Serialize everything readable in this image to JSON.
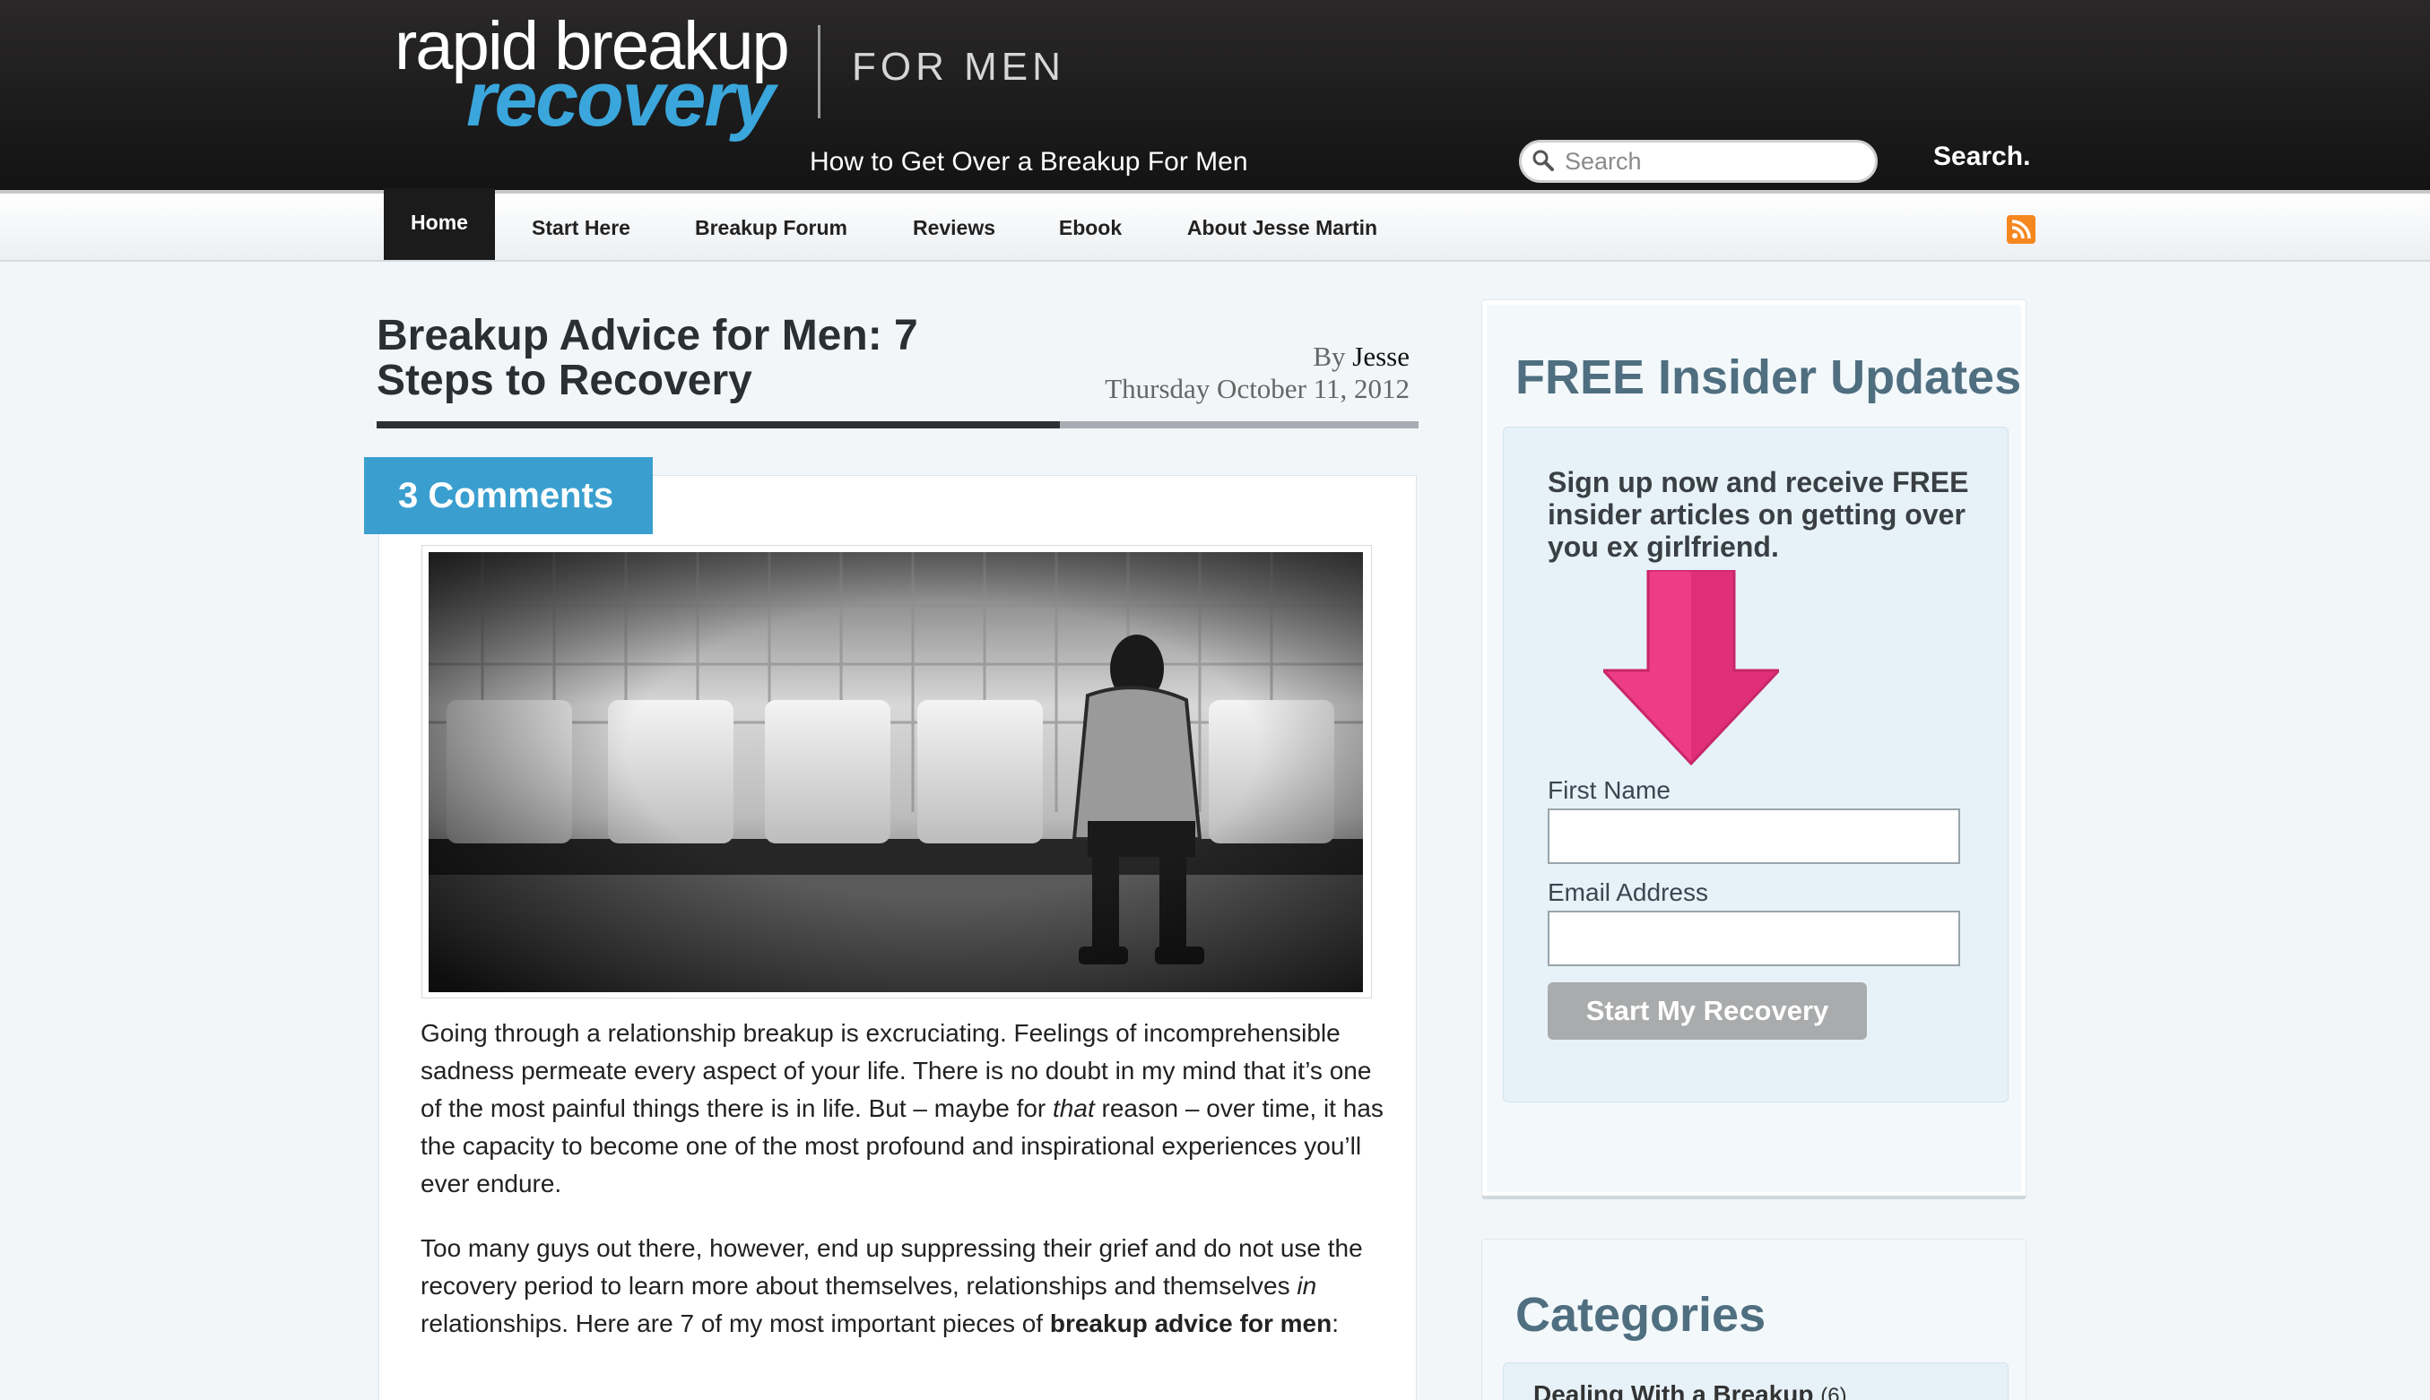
{
  "header": {
    "logo_line1": "rapid breakup",
    "logo_line2": "recovery",
    "sub_brand": "FOR MEN",
    "tagline": "How to Get Over a Breakup For Men",
    "search_placeholder": "Search",
    "search_button": "Search."
  },
  "nav": {
    "items": [
      "Home",
      "Start Here",
      "Breakup Forum",
      "Reviews",
      "Ebook",
      "About Jesse Martin"
    ],
    "active": "Home",
    "rss_icon": "rss-icon"
  },
  "post": {
    "title": "Breakup Advice for Men: 7 Steps to Recovery",
    "by_label": "By",
    "author": "Jesse",
    "date": "Thursday October 11, 2012",
    "comments_label": "3 Comments",
    "image": "man sitting alone on bench black-and-white photo",
    "paragraph1": {
      "before": "Going through a relationship breakup is excruciating. Feelings of incomprehensible sadness permeate every aspect of your life. There is no doubt in my mind that it’s one of the most painful things there is in life. But – maybe for ",
      "em": "that",
      "after": " reason – over time, it has the capacity to become one of the most profound and inspirational experiences you’ll ever endure."
    },
    "paragraph2": {
      "before": "Too many guys out there, however, end up suppressing their grief and do not use the recovery period to learn more about themselves, relationships and themselves ",
      "em": "in",
      "middle": " relationships. Here are 7 of my most important pieces of ",
      "strong": "breakup advice for men",
      "after": ":"
    }
  },
  "sidebar": {
    "widget_title": "FREE Insider Updates",
    "signup_text": "Sign up now and receive FREE insider articles on getting over you ex girlfriend.",
    "first_name_label": "First Name",
    "email_label": "Email Address",
    "submit_label": "Start My Recovery",
    "arrow_icon": "arrow-down-icon",
    "arrow_color": "#ee3c86",
    "categories_title": "Categories",
    "category_item": "Dealing With a Breakup",
    "category_count": "(6)"
  },
  "colors": {
    "accent_blue": "#3a9fcf",
    "header_dark": "#1c1b1b",
    "sidebar_title": "#4f6f80"
  }
}
